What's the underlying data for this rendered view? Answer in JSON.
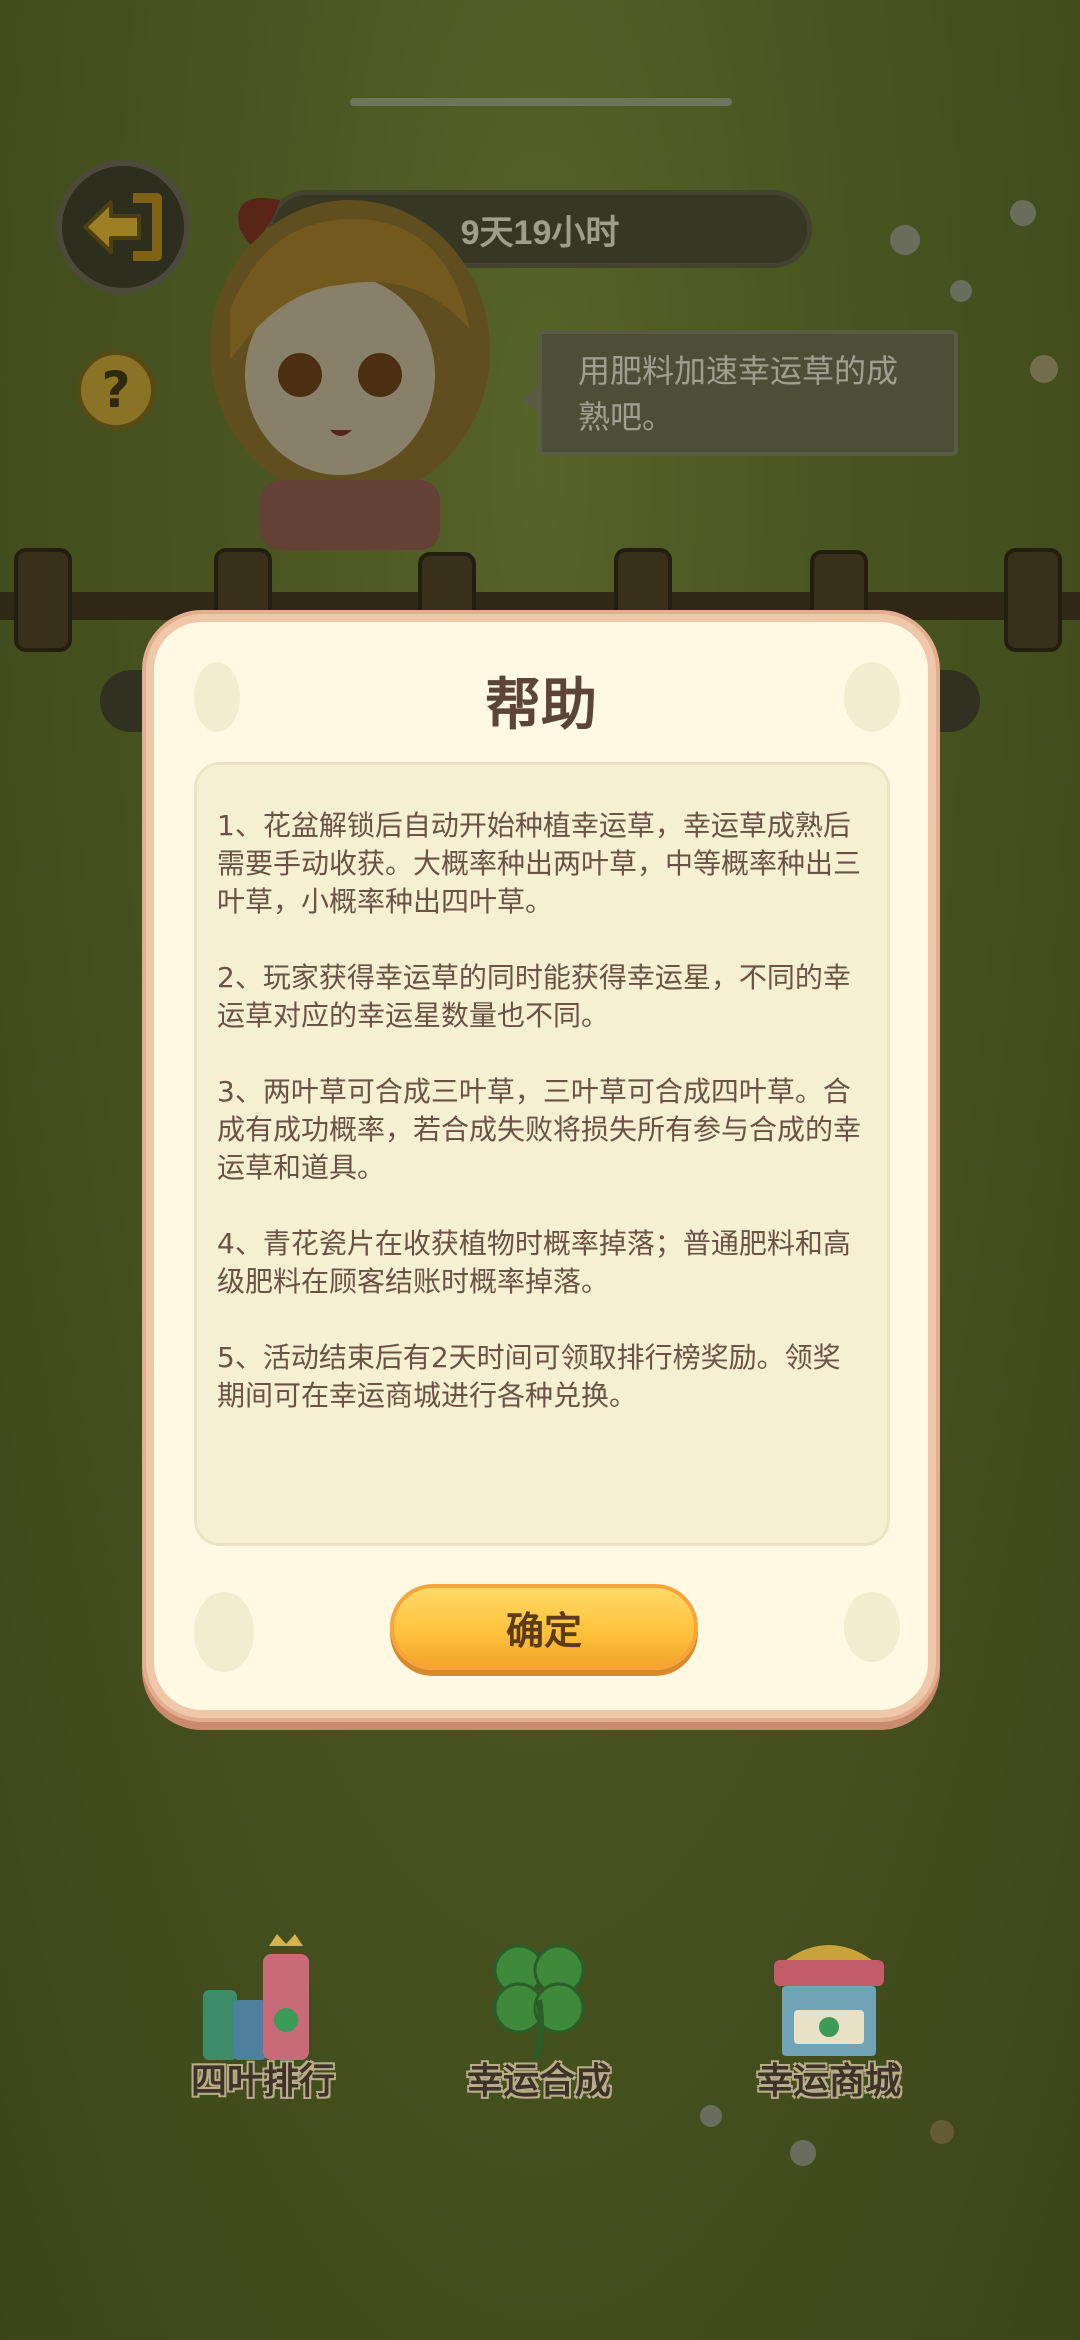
{
  "header": {
    "timer_text": "9天19小时",
    "npc_speech": "用肥料加速幸运草的成熟吧。"
  },
  "icons": {
    "back": "exit-arrow-icon",
    "help": "question-mark-icon"
  },
  "help_dialog": {
    "title": "帮助",
    "paragraphs": [
      "1、花盆解锁后自动开始种植幸运草，幸运草成熟后需要手动收获。大概率种出两叶草，中等概率种出三叶草，小概率种出四叶草。",
      "2、玩家获得幸运草的同时能获得幸运星，不同的幸运草对应的幸运星数量也不同。",
      "3、两叶草可合成三叶草，三叶草可合成四叶草。合成有成功概率，若合成失败将损失所有参与合成的幸运草和道具。",
      "4、青花瓷片在收获植物时概率掉落；普通肥料和高级肥料在顾客结账时概率掉落。",
      "5、活动结束后有2天时间可领取排行榜奖励。领奖期间可在幸运商城进行各种兑换。"
    ],
    "confirm_label": "确定"
  },
  "bottom_nav": [
    {
      "label": "四叶排行",
      "icon": "leaderboard-icon"
    },
    {
      "label": "幸运合成",
      "icon": "clover-icon"
    },
    {
      "label": "幸运商城",
      "icon": "shop-stall-icon"
    }
  ],
  "colors": {
    "background": "#57632a",
    "dialog_bg": "#fff9e4",
    "dialog_border": "#eec8a8",
    "button": "#ffc33d",
    "text": "#6a5245"
  }
}
